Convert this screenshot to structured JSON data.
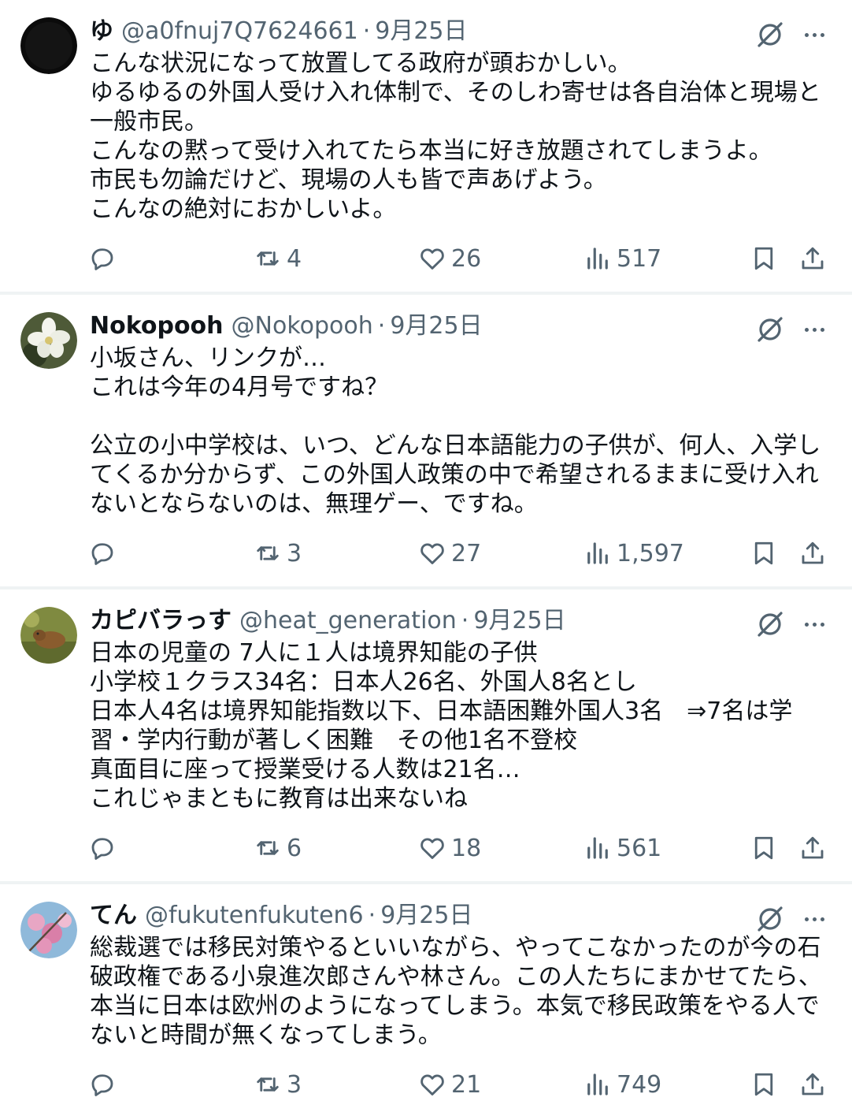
{
  "tweets": [
    {
      "name": "ゆ",
      "handle": "@a0fnuj7Q7624661",
      "date": "9月25日",
      "lines": [
        "こんな状況になって放置してる政府が頭おかしい。",
        "ゆるゆるの外国人受け入れ体制で、そのしわ寄せは各自治体と現場と",
        "一般市民。",
        "こんなの黙って受け入れてたら本当に好き放題されてしまうよ。",
        "市民も勿論だけど、現場の人も皆で声あげよう。",
        "こんなの絶対におかしいよ。"
      ],
      "retweets": "4",
      "likes": "26",
      "views": "517"
    },
    {
      "name": "Nokopooh",
      "handle": "@Nokopooh",
      "date": "9月25日",
      "lines": [
        "小坂さん、リンクが…",
        "これは今年の4月号ですね？",
        "",
        "公立の小中学校は、いつ、どんな日本語能力の子供が、何人、入学し",
        "てくるか分からず、この外国人政策の中で希望されるままに受け入れ",
        "ないとならないのは、無理ゲー、ですね。"
      ],
      "retweets": "3",
      "likes": "27",
      "views": "1,597"
    },
    {
      "name": "カピバラっす",
      "handle": "@heat_generation",
      "date": "9月25日",
      "lines": [
        "日本の児童の 7人に１人は境界知能の子供",
        "小学校１クラス34名：日本人26名、外国人8名とし",
        "日本人4名は境界知能指数以下、日本語困難外国人3名　⇒7名は学",
        "習・学内行動が著しく困難　その他1名不登校",
        "真面目に座って授業受ける人数は21名…",
        "これじゃまともに教育は出来ないね"
      ],
      "retweets": "6",
      "likes": "18",
      "views": "561"
    },
    {
      "name": "てん",
      "handle": "@fukutenfukuten6",
      "date": "9月25日",
      "lines": [
        "総裁選では移民対策やるといいながら、やってこなかったのが今の石",
        "破政権である小泉進次郎さんや林さん。この人たちにまかせてたら、",
        "本当に日本は欧州のようになってしまう。本気で移民政策をやる人で",
        "ないと時間が無くなってしまう。"
      ],
      "retweets": "3",
      "likes": "21",
      "views": "749"
    }
  ],
  "icons": {
    "reply": "reply-icon",
    "retweet": "retweet-icon",
    "like": "heart-icon",
    "views": "views-icon",
    "bookmark": "bookmark-icon",
    "share": "share-icon",
    "grok": "grok-icon",
    "more": "more-icon"
  },
  "colors": {
    "text": "#0f1419",
    "secondary": "#536471",
    "divider": "#eff3f4"
  }
}
